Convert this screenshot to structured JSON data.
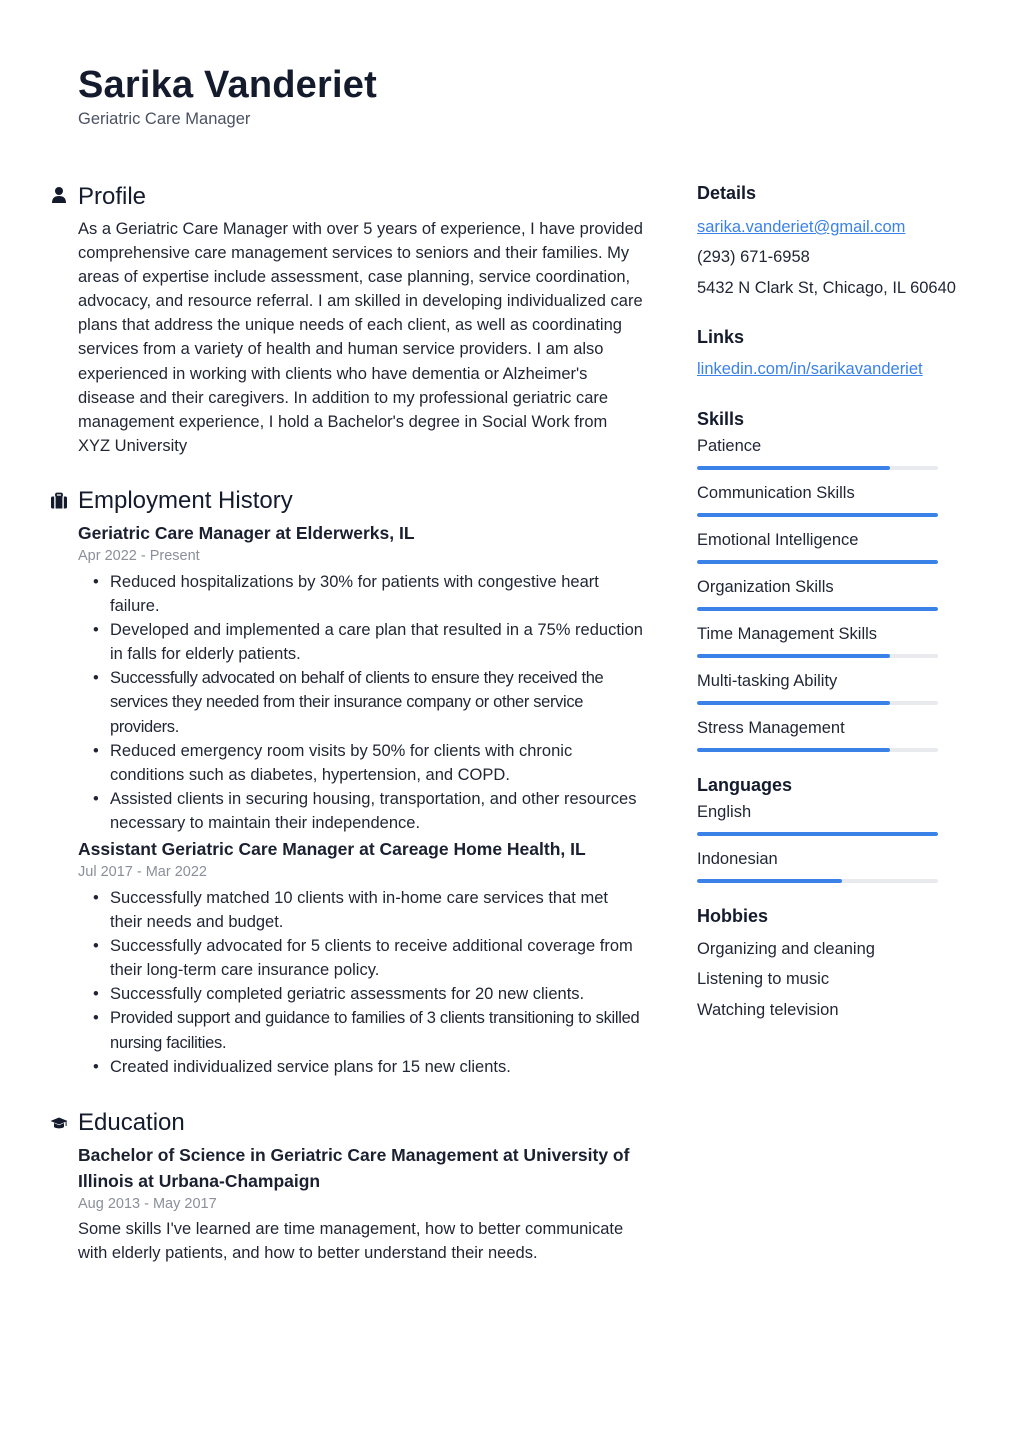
{
  "header": {
    "name": "Sarika Vanderiet",
    "title": "Geriatric Care Manager"
  },
  "profile": {
    "heading": "Profile",
    "icon": "user-icon",
    "text": "As a Geriatric Care Manager with over 5 years of experience, I have provided comprehensive care management services to seniors and their families. My areas of expertise include assessment, case planning, service coordination, advocacy, and resource referral. I am skilled in developing individualized care plans that address the unique needs of each client, as well as coordinating services from a variety of health and human service providers. I am also experienced in working with clients who have dementia or Alzheimer's disease and their caregivers. In addition to my professional geriatric care management experience, I hold a Bachelor's degree in Social Work from XYZ University"
  },
  "employment": {
    "heading": "Employment History",
    "icon": "briefcase-icon",
    "jobs": [
      {
        "title": "Geriatric Care Manager at Elderwerks, IL",
        "dates": "Apr 2022 - Present",
        "bullets": [
          "Reduced hospitalizations by 30% for patients with congestive heart failure.",
          "Developed and implemented a care plan that resulted in a 75% reduction in falls for elderly patients.",
          "Successfully advocated on behalf of clients to ensure they received the services they needed from their insurance company or other service providers.",
          "Reduced emergency room visits by 50% for clients with chronic conditions such as diabetes, hypertension, and COPD.",
          "Assisted clients in securing housing, transportation, and other resources necessary to maintain their independence."
        ]
      },
      {
        "title": "Assistant Geriatric Care Manager at Careage Home Health, IL",
        "dates": "Jul 2017 - Mar 2022",
        "bullets": [
          "Successfully matched 10 clients with in-home care services that met their needs and budget.",
          "Successfully advocated for 5 clients to receive additional coverage from their long-term care insurance policy.",
          "Successfully completed geriatric assessments for 20 new clients.",
          "Provided support and guidance to families of 3 clients transitioning to skilled nursing facilities.",
          "Created individualized service plans for 15 new clients."
        ]
      }
    ]
  },
  "education": {
    "heading": "Education",
    "icon": "graduation-cap-icon",
    "entries": [
      {
        "title": "Bachelor of Science in Geriatric Care Management at University of Illinois at Urbana-Champaign",
        "dates": "Aug 2013 - May 2017",
        "description": "Some skills I've learned are time management, how to better communicate with elderly patients, and how to better understand their needs."
      }
    ]
  },
  "details": {
    "heading": "Details",
    "email": "sarika.vanderiet@gmail.com",
    "phone": "(293) 671-6958",
    "address": "5432 N Clark St, Chicago, IL 60640"
  },
  "links": {
    "heading": "Links",
    "items": [
      "linkedin.com/in/sarikavanderiet"
    ]
  },
  "skills": {
    "heading": "Skills",
    "accent_color": "#3b82e8",
    "items": [
      {
        "label": "Patience",
        "level": 0.8
      },
      {
        "label": "Communication Skills",
        "level": 1.0
      },
      {
        "label": "Emotional Intelligence",
        "level": 1.0
      },
      {
        "label": "Organization Skills",
        "level": 1.0
      },
      {
        "label": "Time Management Skills",
        "level": 0.8
      },
      {
        "label": "Multi-tasking Ability",
        "level": 0.8
      },
      {
        "label": "Stress Management",
        "level": 0.8
      }
    ]
  },
  "languages": {
    "heading": "Languages",
    "items": [
      {
        "label": "English",
        "level": 1.0
      },
      {
        "label": "Indonesian",
        "level": 0.6
      }
    ]
  },
  "hobbies": {
    "heading": "Hobbies",
    "items": [
      "Organizing and cleaning",
      "Listening to music",
      "Watching television"
    ]
  }
}
